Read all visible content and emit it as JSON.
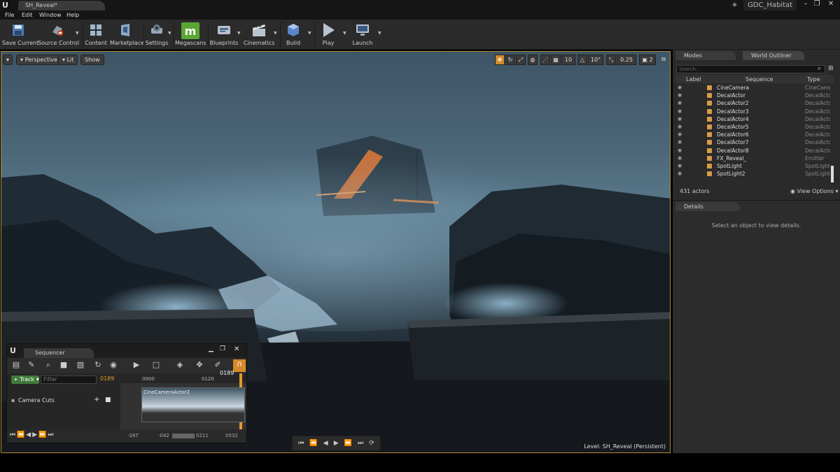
{
  "window": {
    "doc_tab": "SH_Reveal*",
    "project": "GDC_Habitat",
    "minimize": "–",
    "maximize": "❐",
    "close": "✕"
  },
  "menu": [
    "File",
    "Edit",
    "Window",
    "Help"
  ],
  "toolbar": {
    "buttons": [
      {
        "label": "Save Current",
        "icon": "save-icon"
      },
      {
        "label": "Source Control",
        "icon": "source-control-icon"
      },
      {
        "label": "Content",
        "icon": "content-icon"
      },
      {
        "label": "Marketplace",
        "icon": "marketplace-icon"
      },
      {
        "label": "Settings",
        "icon": "settings-icon"
      },
      {
        "label": "Megascans",
        "icon": "megascans-icon"
      },
      {
        "label": "Blueprints",
        "icon": "blueprints-icon"
      },
      {
        "label": "Cinematics",
        "icon": "cinematics-icon"
      },
      {
        "label": "Build",
        "icon": "build-icon"
      },
      {
        "label": "Play",
        "icon": "play-icon"
      },
      {
        "label": "Launch",
        "icon": "launch-icon"
      }
    ]
  },
  "viewport": {
    "perspective": "Perspective",
    "lit": "Lit",
    "show": "Show",
    "grid_snap": "10",
    "rotation_snap": "10°",
    "scale_snap": "0.25",
    "camera_speed": "2",
    "level_prefix": "Level:",
    "level_name": "SH_Reveal (Persistent)"
  },
  "sequencer": {
    "tab": "Sequencer",
    "track_button": "+ Track ▾",
    "filter_placeholder": "Filter",
    "current_frame": "0189",
    "timeline_start": "0000",
    "timeline_mid": "0120",
    "timeline_playhead": "0189",
    "track_name": "Camera Cuts",
    "clip_name": "CineCameraActor2",
    "range_start": "-287",
    "range_view_start": "-042",
    "range_view_end": "0211",
    "range_end": "0532"
  },
  "outliner": {
    "modes_tab": "Modes",
    "tab": "World Outliner",
    "search_placeholder": "Search...",
    "columns": {
      "label": "Label",
      "sequence": "Sequence",
      "type": "Type"
    },
    "rows": [
      {
        "label": "CineCamera",
        "type": "CineCame"
      },
      {
        "label": "DecalActor",
        "type": "DecalActo"
      },
      {
        "label": "DecalActor2",
        "type": "DecalActo"
      },
      {
        "label": "DecalActor3",
        "type": "DecalActo"
      },
      {
        "label": "DecalActor4",
        "type": "DecalActo"
      },
      {
        "label": "DecalActor5",
        "type": "DecalActo"
      },
      {
        "label": "DecalActor6",
        "type": "DecalActo"
      },
      {
        "label": "DecalActor7",
        "type": "DecalActo"
      },
      {
        "label": "DecalActor8",
        "type": "DecalActo"
      },
      {
        "label": "FX_Reveal_",
        "type": "Emitter"
      },
      {
        "label": "SpotLight",
        "type": "SpotLight"
      },
      {
        "label": "SpotLight2",
        "type": "SpotLight"
      }
    ],
    "actor_count": "431 actors",
    "view_options": "View Options ▾"
  },
  "details": {
    "tab": "Details",
    "empty_message": "Select an object to view details."
  },
  "colors": {
    "accent_orange": "#e39a2c",
    "track_green": "#3f7a3a",
    "megascans_green": "#5aa832",
    "viewport_border": "#b08a3a"
  }
}
